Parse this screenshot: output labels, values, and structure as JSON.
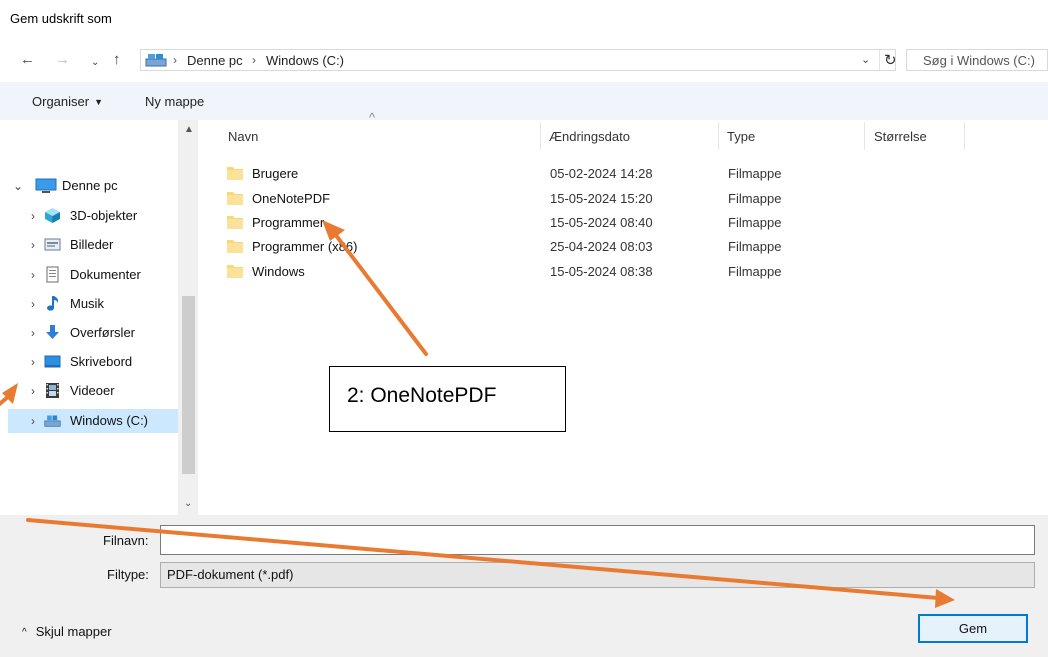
{
  "window": {
    "title": "Gem udskrift som"
  },
  "address_bar": {
    "back_icon": "arrow-left-icon",
    "forward_icon": "arrow-right-icon",
    "recent_icon": "chevron-down-icon",
    "up_icon": "arrow-up-icon",
    "crumbs": [
      "Denne pc",
      "Windows (C:)"
    ],
    "refresh_icon": "refresh-icon"
  },
  "search": {
    "placeholder": "Søg i Windows (C:)"
  },
  "toolbar": {
    "organise_label": "Organiser",
    "new_folder_label": "Ny mappe"
  },
  "nav_pane": {
    "root": {
      "label": "Denne pc",
      "icon": "monitor-icon"
    },
    "items": [
      {
        "label": "3D-objekter",
        "icon": "cube-3d-icon"
      },
      {
        "label": "Billeder",
        "icon": "pictures-icon"
      },
      {
        "label": "Dokumenter",
        "icon": "document-icon"
      },
      {
        "label": "Musik",
        "icon": "music-note-icon"
      },
      {
        "label": "Overførsler",
        "icon": "download-arrow-icon"
      },
      {
        "label": "Skrivebord",
        "icon": "desktop-icon"
      },
      {
        "label": "Videoer",
        "icon": "film-icon"
      },
      {
        "label": "Windows (C:)",
        "icon": "drive-icon",
        "selected": true
      }
    ]
  },
  "file_list": {
    "columns": [
      "Navn",
      "Ændringsdato",
      "Type",
      "Størrelse"
    ],
    "rows": [
      {
        "name": "Brugere",
        "date": "05-02-2024 14:28",
        "type": "Filmappe"
      },
      {
        "name": "OneNotePDF",
        "date": "15-05-2024 15:20",
        "type": "Filmappe"
      },
      {
        "name": "Programmer",
        "date": "15-05-2024 08:40",
        "type": "Filmappe"
      },
      {
        "name": "Programmer (x86)",
        "date": "25-04-2024 08:03",
        "type": "Filmappe"
      },
      {
        "name": "Windows",
        "date": "15-05-2024 08:38",
        "type": "Filmappe"
      }
    ]
  },
  "form": {
    "filename_label": "Filnavn:",
    "filename_value": "",
    "filetype_label": "Filtype:",
    "filetype_value": "PDF-dokument (*.pdf)",
    "hide_folders_label": "Skjul mapper",
    "save_label": "Gem"
  },
  "annotation": {
    "callout_text": "2: OneNotePDF",
    "arrow_color": "#e87b31"
  },
  "colors": {
    "folder": "#f8d775",
    "selection": "#cce8ff",
    "accent": "#0078d7"
  }
}
